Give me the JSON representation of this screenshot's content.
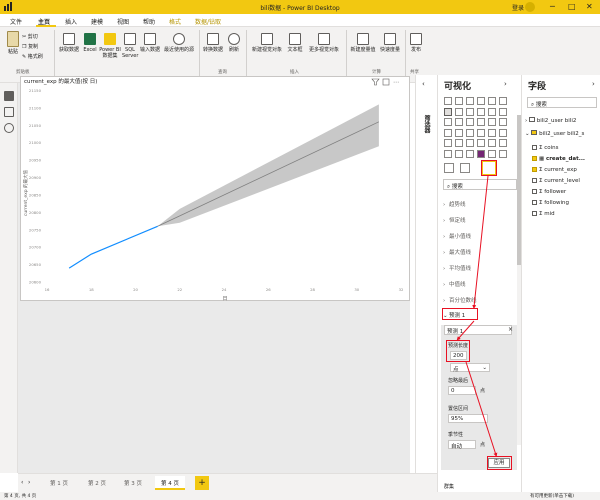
{
  "window": {
    "title": "bili数据 - Power BI Desktop",
    "login": "登录"
  },
  "menu": [
    "文件",
    "主页",
    "插入",
    "建模",
    "视图",
    "帮助",
    "格式",
    "数据/钻取"
  ],
  "ribbon": {
    "clipboard": [
      "剪切",
      "复制",
      "格式刷"
    ],
    "paste": "粘贴",
    "clipboard_group": "剪贴板",
    "data_buttons": [
      "获取数据",
      "Excel",
      "Power BI\n数据集",
      "SQL\nServer",
      "输入数据",
      "最近使用的源"
    ],
    "query_buttons": [
      "转换数据",
      "刷新"
    ],
    "query_group": "查询",
    "insert_buttons": [
      "新建视觉对象",
      "文本框",
      "更多视觉对象"
    ],
    "insert_group": "插入",
    "calc_buttons": [
      "新建度量值",
      "快速度量"
    ],
    "calc_group": "计算",
    "share_buttons": [
      "发布"
    ],
    "share_group": "共享"
  },
  "visual": {
    "title": "current_exp 的最大值(按 日)",
    "ylabel": "current_exp 的最大值",
    "xlabel": "日"
  },
  "chart_data": {
    "type": "line",
    "title": "current_exp 的最大值(按 日)",
    "xlabel": "日",
    "ylabel": "current_exp 的最大值",
    "xlim": [
      16,
      32
    ],
    "x_ticks": [
      "16",
      "18",
      "20",
      "22",
      "24",
      "26",
      "28",
      "30",
      "32"
    ],
    "ylim": [
      20600,
      21160
    ],
    "y_ticks": [
      "20600",
      "20650",
      "20700",
      "20750",
      "20800",
      "20850",
      "20900",
      "20950",
      "21000",
      "21050",
      "21100",
      "21150"
    ],
    "series": [
      {
        "kind": "actual",
        "x": [
          17,
          18,
          21
        ],
        "y": [
          20640,
          20680,
          20760
        ]
      },
      {
        "kind": "forecast",
        "x": [
          21,
          22,
          31
        ],
        "y": [
          20760,
          20790,
          21060
        ],
        "lower": [
          20760,
          20770,
          20990
        ],
        "upper": [
          20760,
          20810,
          21110
        ]
      }
    ],
    "colors": {
      "actual": "#118dff",
      "forecast": "#808080",
      "band": "#c8c8c8"
    }
  },
  "filters_label": "筛选器",
  "viz": {
    "header": "可视化",
    "search_placeholder": "搜索",
    "analytics": [
      "趋势线",
      "恒定线",
      "最小值线",
      "最大值线",
      "平均值线",
      "中值线",
      "百分位数线"
    ],
    "forecast_header": "预测  1",
    "forecast_name": "预测 1",
    "forecast_length_label": "预测长度",
    "forecast_length_value": "200",
    "forecast_unit": "点",
    "ignore_last_label": "忽略最后",
    "ignore_last_value": "0",
    "ignore_last_unit": "点",
    "confidence_label": "置信区间",
    "confidence_value": "95%",
    "seasonality_label": "季节性",
    "seasonality_value": "自动",
    "seasonality_unit": "点",
    "apply": "应用",
    "bottom": "群集"
  },
  "fields": {
    "header": "字段",
    "search_placeholder": "搜索",
    "tables": [
      {
        "name": "bili2_user bili2",
        "expanded": false
      },
      {
        "name": "bili2_user bili2_s",
        "expanded": true
      }
    ],
    "items": [
      {
        "name": "coins",
        "checked": false
      },
      {
        "name": "create_dat...",
        "checked": true
      },
      {
        "name": "current_exp",
        "checked": true
      },
      {
        "name": "current_level",
        "checked": false
      },
      {
        "name": "follower",
        "checked": false
      },
      {
        "name": "following",
        "checked": false
      },
      {
        "name": "mid",
        "checked": false
      }
    ]
  },
  "tabs": [
    "第 1 页",
    "第 2 页",
    "第 3 页",
    "第 4 页"
  ],
  "active_tab": 3,
  "status": {
    "left": "第 4 页, 共 4 页",
    "right": "有可用更新(单击下载)"
  }
}
